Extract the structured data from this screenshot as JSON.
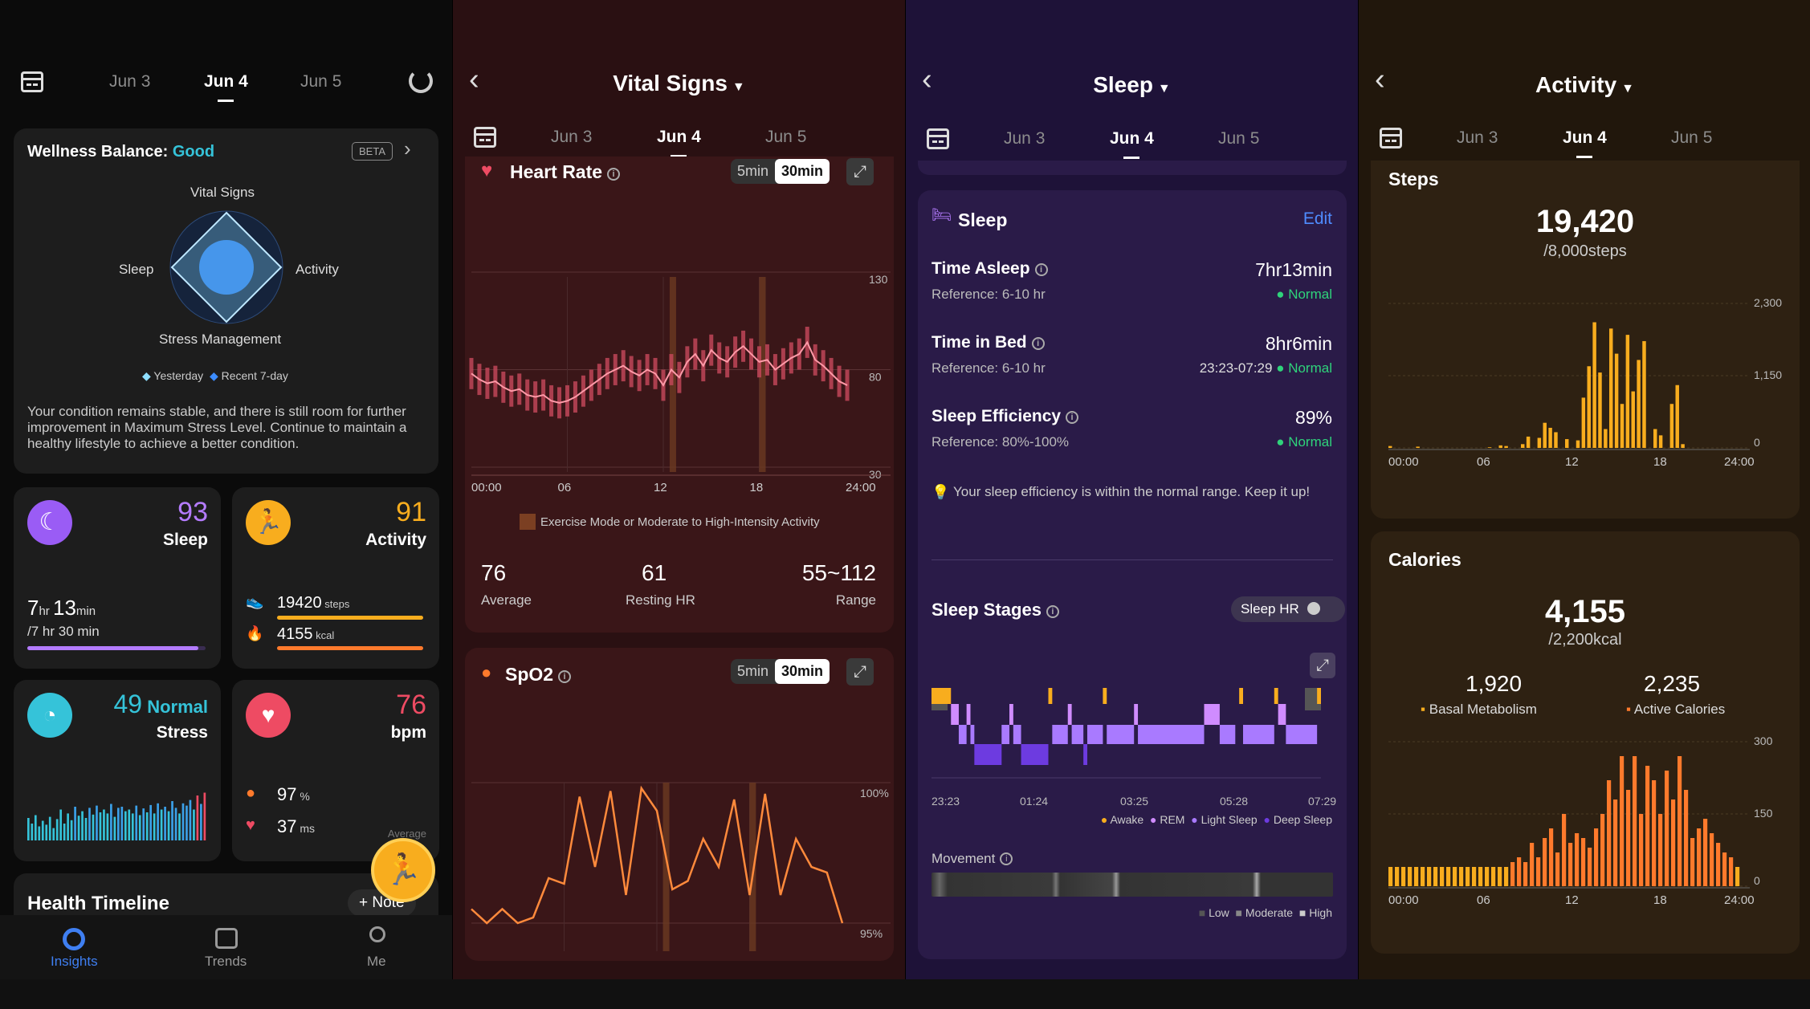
{
  "dates": {
    "prev": "Jun 3",
    "current": "Jun 4",
    "next": "Jun 5"
  },
  "colors": {
    "sleep": "#9a5cf5",
    "activity": "#f8ad1e",
    "stress": "#35c3d9",
    "heart": "#ee4b63",
    "calories": "#ff7a2c",
    "normal": "#2fd37b",
    "link": "#4f8cff"
  },
  "insights": {
    "wellness_label": "Wellness Balance:",
    "wellness_value": "Good",
    "beta": "BETA",
    "radar": {
      "top": "Vital Signs",
      "left": "Sleep",
      "right": "Activity",
      "bottom": "Stress Management"
    },
    "legend": {
      "yesterday": "Yesterday",
      "recent": "Recent 7-day"
    },
    "summary": "Your condition remains stable, and there is still room for further improvement in Maximum Stress Level. Continue to maintain a healthy lifestyle to achieve a better condition.",
    "sleep_card": {
      "score": "93",
      "label": "Sleep",
      "hr": "7",
      "hr_unit": "hr",
      "min": "13",
      "min_unit": "min",
      "goal": "/7 hr 30 min",
      "progress": 0.96
    },
    "activity_card": {
      "score": "91",
      "label": "Activity",
      "steps": "19420",
      "steps_unit": "steps",
      "kcal": "4155",
      "kcal_unit": "kcal"
    },
    "stress_card": {
      "score": "49",
      "level": "Normal",
      "label": "Stress"
    },
    "heart_card": {
      "value": "76",
      "unit": "bpm",
      "spo2": "97",
      "spo2_unit": "%",
      "hrv": "37",
      "hrv_unit": "ms",
      "avg": "Average"
    },
    "timeline_title": "Health Timeline",
    "note_label": "+ Note",
    "nav": {
      "insights": "Insights",
      "trends": "Trends",
      "me": "Me"
    }
  },
  "vital": {
    "title": "Vital Signs",
    "heart_rate": "Heart Rate",
    "interval_a": "5min",
    "interval_b": "30min",
    "hr_y_ticks": [
      "130",
      "80",
      "30"
    ],
    "x_ticks": [
      "00:00",
      "06",
      "12",
      "18",
      "24:00"
    ],
    "exercise_legend": "Exercise Mode or Moderate to High-Intensity Activity",
    "stats": [
      {
        "value": "76",
        "label": "Average"
      },
      {
        "value": "61",
        "label": "Resting HR"
      },
      {
        "value": "55~112",
        "label": "Range"
      }
    ],
    "spo2": "SpO2",
    "spo2_ticks": [
      "100%",
      "95%"
    ]
  },
  "sleep": {
    "title": "Sleep",
    "card_title": "Sleep",
    "edit": "Edit",
    "rows": [
      {
        "label": "Time Asleep",
        "ref": "Reference: 6-10 hr",
        "value": "7hr13min",
        "extra": "",
        "status": "Normal"
      },
      {
        "label": "Time in Bed",
        "ref": "Reference: 6-10 hr",
        "value": "8hr6min",
        "extra": "23:23-07:29",
        "status": "Normal"
      },
      {
        "label": "Sleep Efficiency",
        "ref": "Reference: 80%-100%",
        "value": "89%",
        "extra": "",
        "status": "Normal"
      }
    ],
    "tip": "Your sleep efficiency is within the normal range. Keep it up!",
    "stages_title": "Sleep Stages",
    "sleep_hr": "Sleep HR",
    "stage_ticks": [
      "23:23",
      "01:24",
      "03:25",
      "05:28",
      "07:29"
    ],
    "stage_legend": {
      "awake": "Awake",
      "rem": "REM",
      "light": "Light Sleep",
      "deep": "Deep Sleep"
    },
    "movement": "Movement",
    "movement_legend": {
      "low": "Low",
      "moderate": "Moderate",
      "high": "High"
    }
  },
  "activity": {
    "title": "Activity",
    "steps_title": "Steps",
    "steps_value": "19,420",
    "steps_goal": "/8,000steps",
    "steps_ticks": [
      "2,300",
      "1,150",
      "0"
    ],
    "x_ticks": [
      "00:00",
      "06",
      "12",
      "18",
      "24:00"
    ],
    "calories_title": "Calories",
    "calories_value": "4,155",
    "calories_goal": "/2,200kcal",
    "basal_value": "1,920",
    "basal_label": "Basal Metabolism",
    "active_value": "2,235",
    "active_label": "Active Calories",
    "cal_ticks": [
      "300",
      "150",
      "0"
    ]
  },
  "chart_data": [
    {
      "type": "line",
      "title": "Heart Rate",
      "x_unit": "hour",
      "ylim": [
        30,
        130
      ],
      "x": [
        0,
        0.5,
        1,
        1.5,
        2,
        2.5,
        3,
        3.5,
        4,
        4.5,
        5,
        5.5,
        6,
        6.5,
        7,
        7.5,
        8,
        8.5,
        9,
        9.5,
        10,
        10.5,
        11,
        11.5,
        12,
        12.5,
        13,
        13.5,
        14,
        14.5,
        15,
        15.5,
        16,
        16.5,
        17,
        17.5,
        18,
        18.5,
        19,
        19.5,
        20,
        20.5,
        21,
        21.5,
        22,
        22.5,
        23,
        23.5
      ],
      "values": [
        78,
        75,
        73,
        74,
        71,
        69,
        70,
        67,
        66,
        67,
        64,
        63,
        64,
        66,
        69,
        72,
        75,
        78,
        80,
        82,
        79,
        77,
        80,
        78,
        72,
        80,
        76,
        84,
        88,
        82,
        90,
        86,
        84,
        89,
        92,
        88,
        84,
        85,
        80,
        83,
        86,
        88,
        94,
        85,
        82,
        78,
        74,
        72
      ]
    },
    {
      "type": "line",
      "title": "SpO2",
      "x_unit": "hour",
      "ylim": [
        94,
        100
      ],
      "x": [
        0,
        1,
        2,
        3,
        4,
        5,
        6,
        7,
        8,
        9,
        10,
        11,
        12,
        13,
        14,
        15,
        16,
        17,
        18,
        19,
        20,
        21,
        22,
        23,
        24
      ],
      "values": [
        95.5,
        95,
        95.5,
        95,
        95.2,
        96.6,
        96.4,
        99.5,
        97,
        99.7,
        96,
        99.8,
        99,
        96.2,
        96.5,
        98,
        97,
        99.4,
        96,
        99.6,
        96,
        98,
        97,
        96.8,
        95
      ]
    },
    {
      "type": "bar",
      "title": "Steps",
      "ylim": [
        0,
        2300
      ],
      "x_unit": "hour",
      "values": [
        30,
        0,
        0,
        0,
        0,
        20,
        0,
        0,
        0,
        0,
        0,
        0,
        0,
        0,
        0,
        0,
        0,
        0,
        10,
        0,
        40,
        30,
        0,
        0,
        60,
        180,
        0,
        160,
        400,
        320,
        250,
        0,
        140,
        0,
        120,
        800,
        1300,
        2000,
        1200,
        300,
        1900,
        1500,
        700,
        1800,
        900,
        1400,
        1700,
        0,
        300,
        200,
        0,
        700,
        1000,
        60,
        0,
        0,
        0,
        0,
        0,
        0,
        0,
        0,
        0,
        0
      ],
      "grid": true
    },
    {
      "type": "bar",
      "title": "Calories",
      "ylim": [
        0,
        300
      ],
      "x_unit": "hour",
      "values": [
        40,
        40,
        40,
        40,
        40,
        40,
        40,
        40,
        40,
        40,
        40,
        40,
        40,
        40,
        40,
        40,
        40,
        40,
        40,
        50,
        60,
        50,
        90,
        60,
        100,
        120,
        70,
        150,
        90,
        110,
        100,
        80,
        120,
        150,
        220,
        180,
        270,
        200,
        270,
        150,
        250,
        220,
        150,
        240,
        180,
        270,
        200,
        100,
        120,
        140,
        110,
        90,
        70,
        60,
        40
      ],
      "grid": true
    },
    {
      "type": "bar",
      "title": "Stress",
      "ylim": [
        0,
        100
      ],
      "values": [
        40,
        30,
        45,
        25,
        35,
        28,
        42,
        22,
        38,
        55,
        30,
        48,
        36,
        60,
        44,
        52,
        40,
        58,
        46,
        62,
        50,
        55,
        48,
        65,
        42,
        58,
        60,
        52,
        55,
        48,
        62,
        45,
        57,
        50,
        63,
        48,
        66,
        55,
        60,
        52,
        70,
        58,
        48,
        66,
        62,
        72,
        55,
        80,
        65,
        85
      ]
    }
  ]
}
